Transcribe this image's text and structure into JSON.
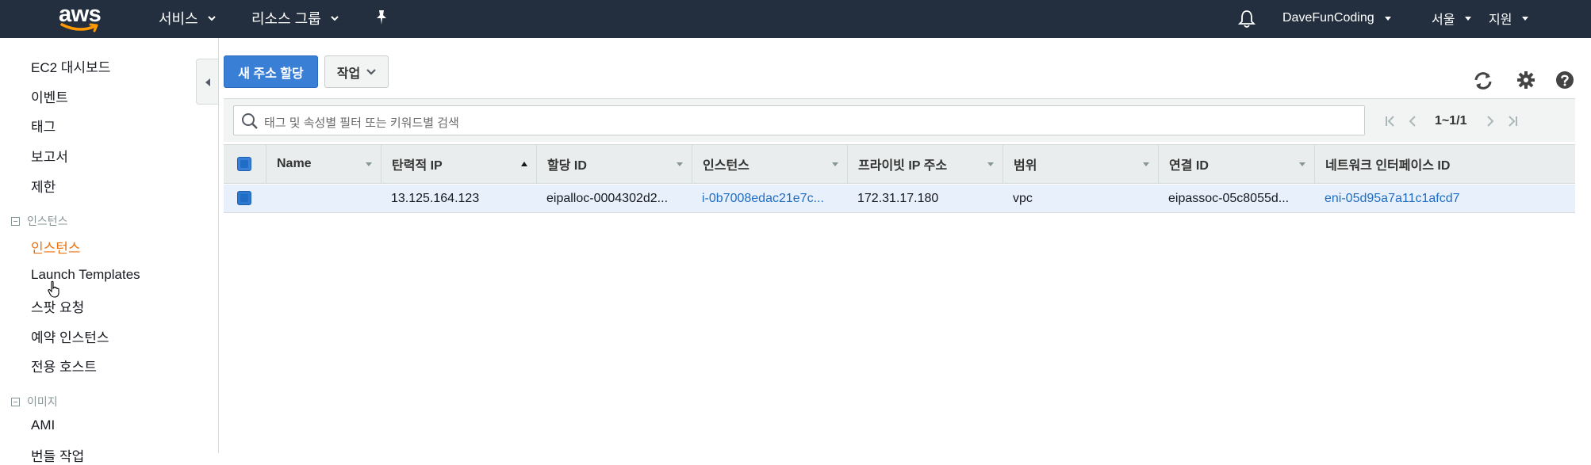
{
  "topnav": {
    "logo_text": "aws",
    "services": "서비스",
    "resource_groups": "리소스 그룹",
    "pin_icon": "pin-icon",
    "bell_icon": "bell-icon",
    "user": "DaveFunCoding",
    "region": "서울",
    "support": "지원"
  },
  "sidebar": {
    "items": [
      {
        "label": "EC2 대시보드"
      },
      {
        "label": "이벤트"
      },
      {
        "label": "태그"
      },
      {
        "label": "보고서"
      },
      {
        "label": "제한"
      }
    ],
    "section_instances": "인스턴스",
    "instances_items": [
      {
        "label": "인스턴스",
        "active": true
      },
      {
        "label": "Launch Templates"
      },
      {
        "label": "스팟 요청"
      },
      {
        "label": "예약 인스턴스"
      },
      {
        "label": "전용 호스트"
      }
    ],
    "section_images": "이미지",
    "images_items": [
      {
        "label": "AMI"
      },
      {
        "label": "번들 작업"
      }
    ],
    "active_color": "#ec7211"
  },
  "toolbar": {
    "allocate_button": "새 주소 할당",
    "actions_button": "작업",
    "icons": [
      "refresh-icon",
      "settings-icon",
      "help-icon"
    ]
  },
  "search": {
    "placeholder": "태그 및 속성별 필터 또는 키워드별 검색",
    "pager_text": "1~1/1"
  },
  "table": {
    "columns": [
      "Name",
      "탄력적 IP",
      "할당 ID",
      "인스턴스",
      "프라이빗 IP 주소",
      "범위",
      "연결 ID",
      "네트워크 인터페이스 ID"
    ],
    "sorted_column": "탄력적 IP",
    "rows": [
      {
        "name": "",
        "elastic_ip": "13.125.164.123",
        "allocation_id": "eipalloc-0004302d2...",
        "instance": "i-0b7008edac21e7c...",
        "private_ip": "172.31.17.180",
        "scope": "vpc",
        "association_id": "eipassoc-05c8055d...",
        "network_interface_id": "eni-05d95a7a11c1afcd7"
      }
    ]
  },
  "colors": {
    "nav_bg": "#232f3e",
    "primary": "#3a7fd6",
    "link": "#1f6dc4",
    "selected_row": "#e8f0fb"
  }
}
